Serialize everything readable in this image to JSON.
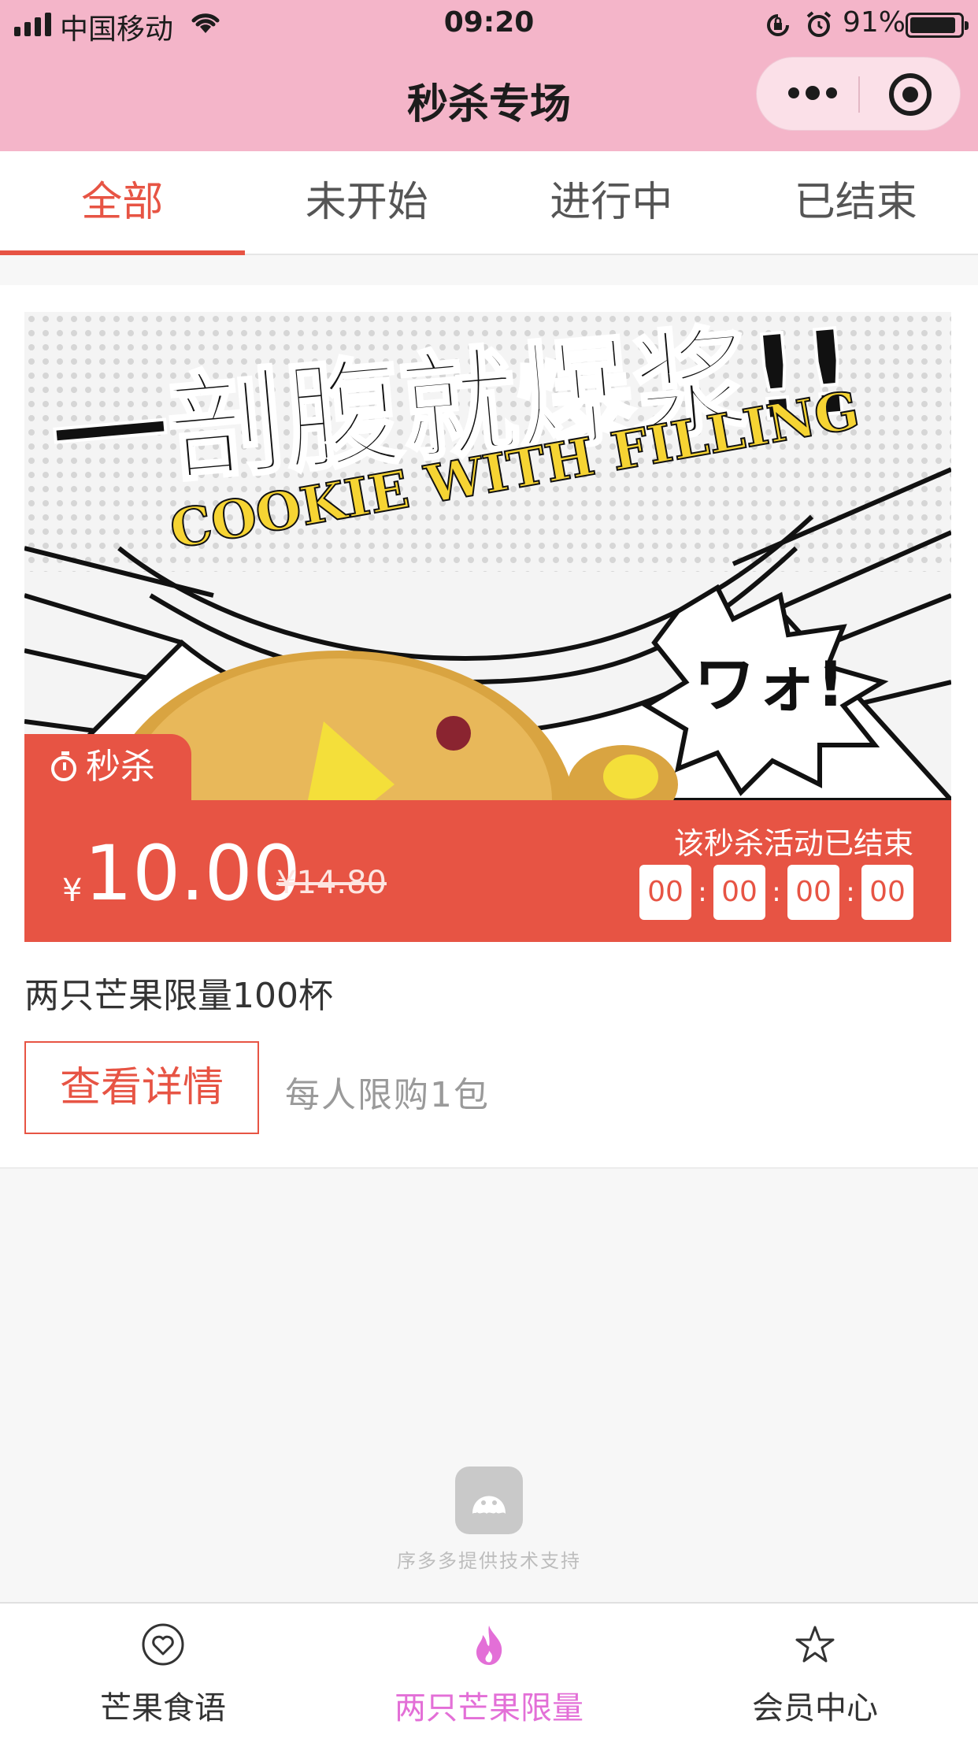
{
  "status_bar": {
    "carrier": "中国移动",
    "time": "09:20",
    "battery_percent": "91%",
    "battery_level": 0.91
  },
  "nav": {
    "title": "秒杀专场"
  },
  "tabs": [
    {
      "label": "全部",
      "active": true
    },
    {
      "label": "未开始",
      "active": false
    },
    {
      "label": "进行中",
      "active": false
    },
    {
      "label": "已结束",
      "active": false
    }
  ],
  "card": {
    "banner": {
      "headline": "一剖腹就爆浆!!",
      "subtitle": "COOKIE WITH FILLING",
      "bubble": "ワォ!"
    },
    "tag_label": "秒杀",
    "currency": "¥",
    "price": "10.00",
    "original_price": "¥14.80",
    "status_text": "该秒杀活动已结束",
    "countdown": [
      "00",
      "00",
      "00",
      "00"
    ],
    "countdown_separator": ":",
    "product_name": "两只芒果限量100杯",
    "detail_button": "查看详情",
    "limit_text": "每人限购1包"
  },
  "support_text": "序多多提供技术支持",
  "tabbar": [
    {
      "label": "芒果食语",
      "icon": "heart-icon",
      "active": false
    },
    {
      "label": "两只芒果限量",
      "icon": "flame-icon",
      "active": true
    },
    {
      "label": "会员中心",
      "icon": "star-icon",
      "active": false
    }
  ],
  "colors": {
    "header_pink": "#f4b5c9",
    "accent_red": "#e75444",
    "active_tab_magenta": "#e36fd7"
  }
}
